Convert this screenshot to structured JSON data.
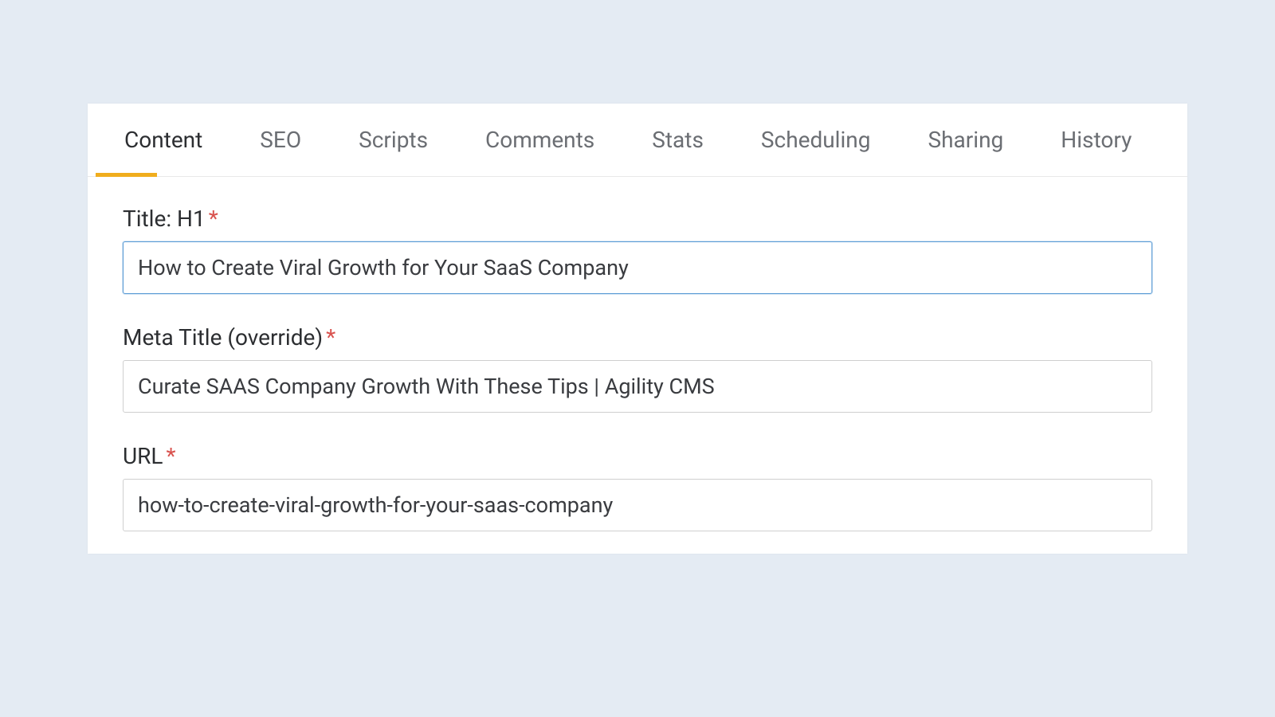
{
  "tabs": [
    {
      "id": "content",
      "label": "Content",
      "active": true
    },
    {
      "id": "seo",
      "label": "SEO",
      "active": false
    },
    {
      "id": "scripts",
      "label": "Scripts",
      "active": false
    },
    {
      "id": "comments",
      "label": "Comments",
      "active": false
    },
    {
      "id": "stats",
      "label": "Stats",
      "active": false
    },
    {
      "id": "scheduling",
      "label": "Scheduling",
      "active": false
    },
    {
      "id": "sharing",
      "label": "Sharing",
      "active": false
    },
    {
      "id": "history",
      "label": "History",
      "active": false
    }
  ],
  "fields": {
    "title": {
      "label": "Title: H1",
      "required": true,
      "value": "How to Create Viral Growth for Your SaaS Company",
      "focused": true
    },
    "meta_title": {
      "label": "Meta Title (override)",
      "required": true,
      "value": "Curate SAAS Company Growth With These Tips | Agility CMS",
      "focused": false
    },
    "url": {
      "label": "URL",
      "required": true,
      "value": "how-to-create-viral-growth-for-your-saas-company",
      "focused": false
    }
  },
  "required_marker": "*"
}
